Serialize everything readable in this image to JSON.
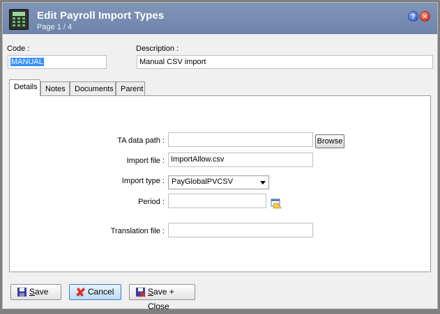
{
  "window": {
    "title": "Edit Payroll Import Types",
    "subtitle": "Page 1 / 4",
    "help_glyph": "?",
    "close_glyph": "✕"
  },
  "header": {
    "code_label": "Code :",
    "code_value": "MANUAL",
    "description_label": "Description :",
    "description_value": "Manual CSV import"
  },
  "tabs": [
    {
      "label": "Details",
      "active": true
    },
    {
      "label": "Notes",
      "active": false
    },
    {
      "label": "Documents",
      "active": false
    },
    {
      "label": "Parent",
      "active": false
    }
  ],
  "details": {
    "ta_data_path_label": "TA data path :",
    "ta_data_path_value": "",
    "browse_label": "Browse",
    "import_file_label": "Import file :",
    "import_file_value": "ImportAllow.csv",
    "import_type_label": "Import type :",
    "import_type_value": "PayGlobalPVCSV",
    "period_label": "Period :",
    "period_value": "",
    "translation_file_label": "Translation file :",
    "translation_file_value": ""
  },
  "footer": {
    "save_underlined": "S",
    "save_rest": "ave",
    "cancel_label": "Cancel",
    "save_close_underlined": "S",
    "save_close_rest": "ave + Close"
  },
  "colors": {
    "titlebar": "#7489ad",
    "selection": "#3390ff",
    "cancel_accent": "#3d7bbf"
  },
  "icons": [
    "calculator-icon",
    "help-icon",
    "close-icon",
    "calendar-folder-icon",
    "save-icon",
    "cancel-icon",
    "save-close-icon"
  ]
}
